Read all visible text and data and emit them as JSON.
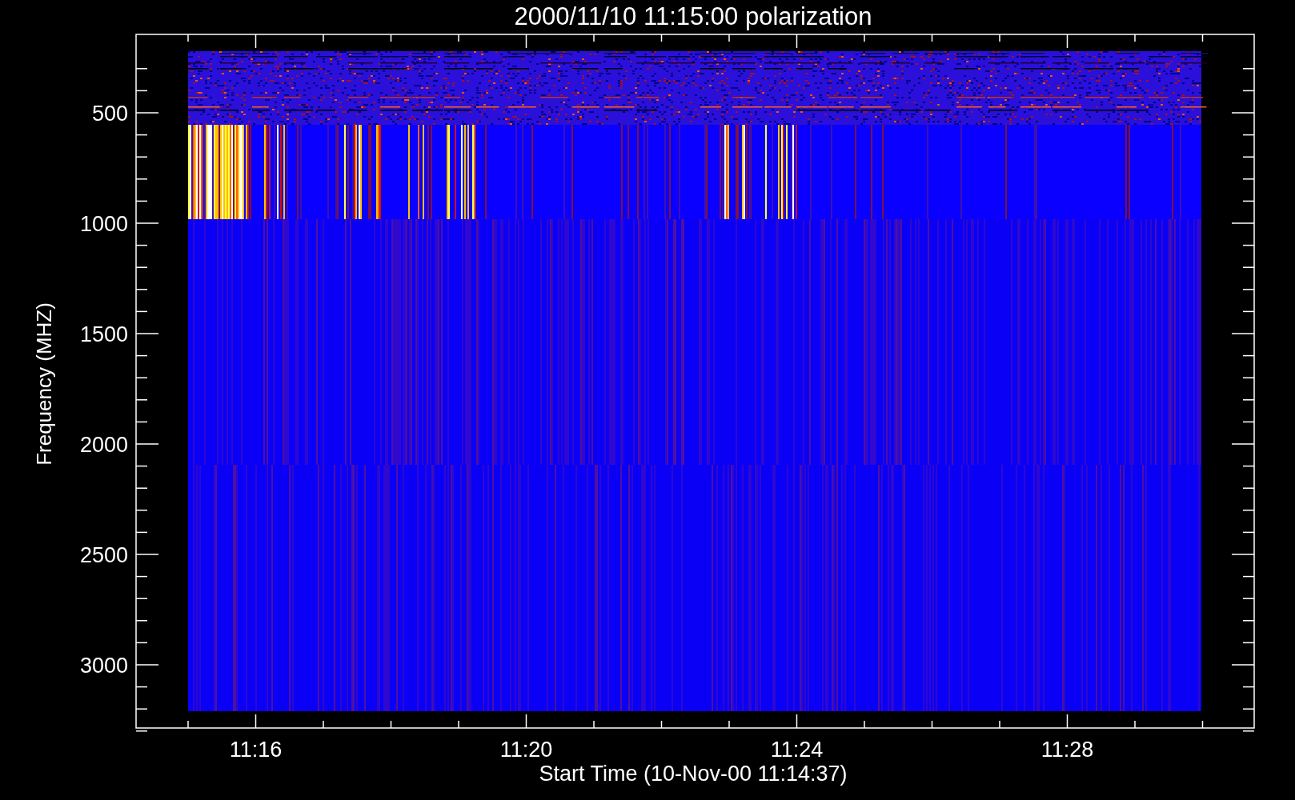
{
  "plot": {
    "title": "2000/11/10 11:15:00 polarization",
    "y_axis": {
      "label": "Frequency (MHZ)",
      "ticks": [
        "500",
        "1000",
        "1500",
        "2000",
        "2500",
        "3000"
      ]
    },
    "x_axis": {
      "label": "Start Time (10-Nov-00 11:14:37)",
      "ticks": [
        "11:16",
        "11:20",
        "11:24",
        "11:28"
      ]
    }
  }
}
